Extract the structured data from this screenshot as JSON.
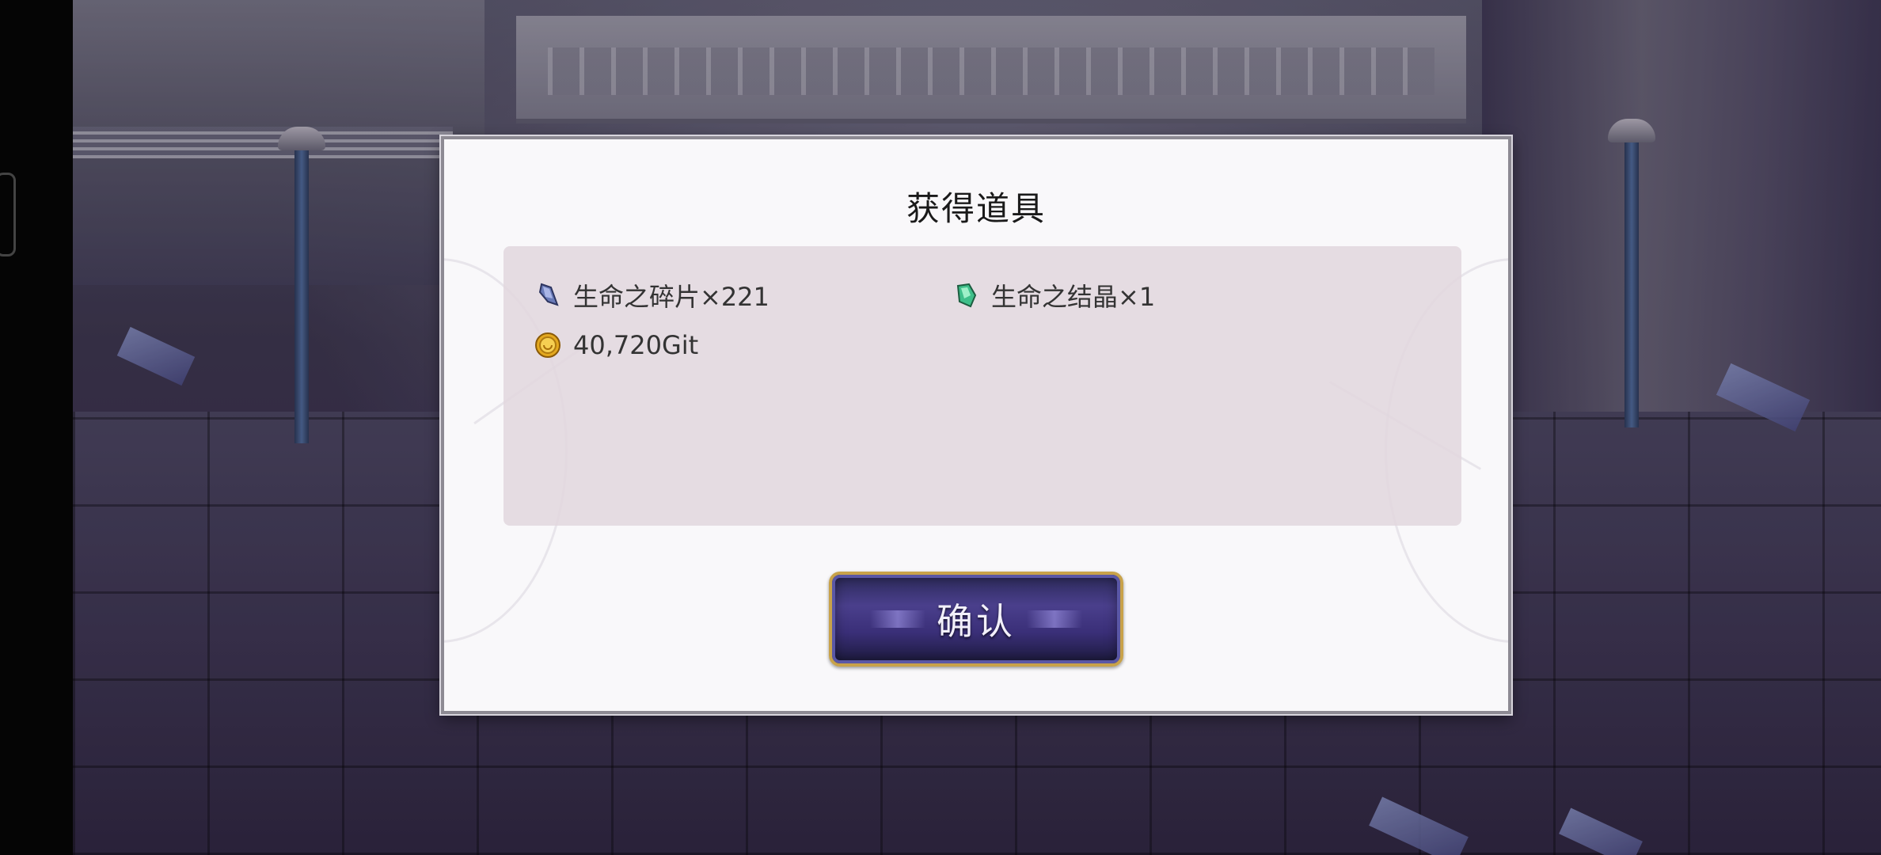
{
  "dialog": {
    "title": "获得道具",
    "items": [
      {
        "label": "生命之碎片×221",
        "icon": "crystal-shard-icon",
        "icon_color": "#6a7bb8"
      },
      {
        "label": "生命之结晶×1",
        "icon": "green-crystal-icon",
        "icon_color": "#3fbf8a"
      },
      {
        "label": "40,720Git",
        "icon": "gold-coin-icon",
        "icon_color": "#e3a81f"
      }
    ],
    "confirm_label": "确认"
  },
  "colors": {
    "dialog_bg": "#f9f8fa",
    "panel_bg": "#e1d7de",
    "button_gold": "#c8a24a",
    "button_purple": "#3a2f78"
  }
}
